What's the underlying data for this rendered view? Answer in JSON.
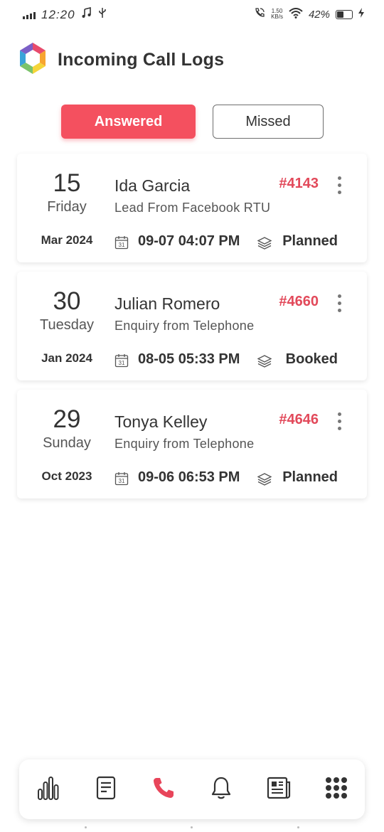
{
  "status_bar": {
    "time": "12:20",
    "speed_value": "1.50",
    "speed_unit": "KB/s",
    "battery": "42%",
    "battery_level": 0.42
  },
  "header": {
    "title": "Incoming Call Logs",
    "logo_icon": "hexagon-logo-icon"
  },
  "tabs": [
    {
      "label": "Answered",
      "active": true
    },
    {
      "label": "Missed",
      "active": false
    }
  ],
  "calls": [
    {
      "day": "15",
      "weekday": "Friday",
      "month_year": "Mar 2024",
      "name": "Ida Garcia",
      "ref": "#4143",
      "source": "Lead From Facebook RTU",
      "datetime": "09-07 04:07 PM",
      "status": "Planned"
    },
    {
      "day": "30",
      "weekday": "Tuesday",
      "month_year": "Jan 2024",
      "name": "Julian Romero",
      "ref": "#4660",
      "source": "Enquiry from Telephone",
      "datetime": "08-05 05:33 PM",
      "status": "Booked"
    },
    {
      "day": "29",
      "weekday": "Sunday",
      "month_year": "Oct 2023",
      "name": "Tonya Kelley",
      "ref": "#4646",
      "source": "Enquiry from Telephone",
      "datetime": "09-06 06:53 PM",
      "status": "Planned"
    }
  ],
  "calendar_icon_text": "31",
  "bottom_nav": [
    {
      "icon": "bar-chart-icon",
      "active": false
    },
    {
      "icon": "document-icon",
      "active": false
    },
    {
      "icon": "phone-icon",
      "active": true
    },
    {
      "icon": "bell-icon",
      "active": false
    },
    {
      "icon": "newspaper-icon",
      "active": false
    },
    {
      "icon": "grid-dots-icon",
      "active": false
    }
  ],
  "colors": {
    "accent": "#f4505f",
    "ref_red": "#e2495a",
    "text": "#333333"
  }
}
